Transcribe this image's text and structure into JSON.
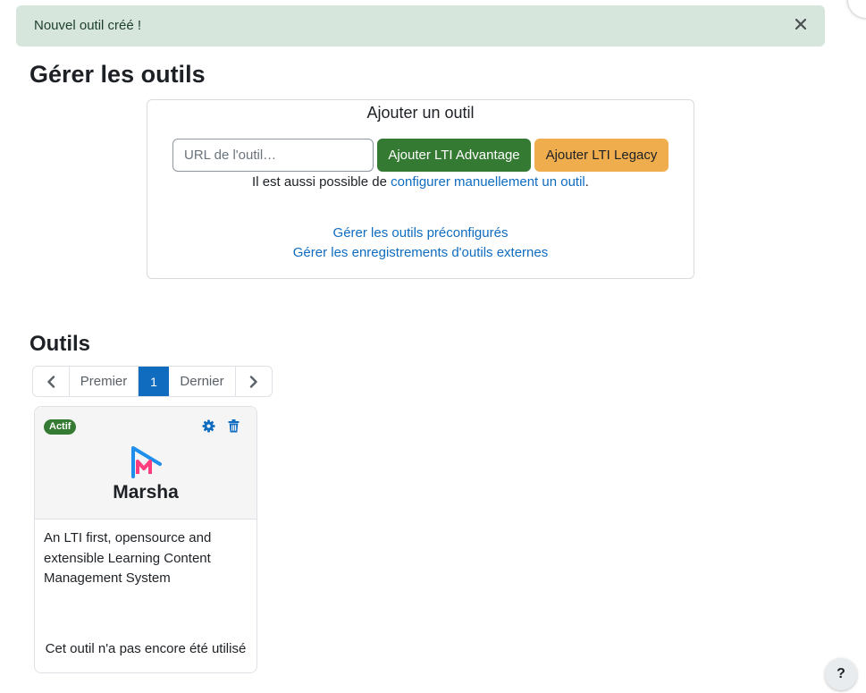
{
  "alert": {
    "message": "Nouvel outil créé !",
    "close_icon": "close-icon"
  },
  "page": {
    "title": "Gérer les outils"
  },
  "add_tool": {
    "heading": "Ajouter un outil",
    "url_placeholder": "URL de l'outil…",
    "url_value": "",
    "advantage_button": "Ajouter LTI Advantage",
    "legacy_button": "Ajouter LTI Legacy",
    "hint_prefix": "Il est aussi possible de ",
    "hint_link": "configurer manuellement un outil",
    "hint_suffix": ".",
    "link_preconfigured": "Gérer les outils préconfigurés",
    "link_registrations": "Gérer les enregistrements d'outils externes"
  },
  "tools_section": {
    "title": "Outils",
    "pagination": {
      "first": "Premier",
      "current": "1",
      "last": "Dernier"
    }
  },
  "tools": [
    {
      "status": "Actif",
      "name": "Marsha",
      "description": "An LTI first, opensource and extensible Learning Content Management System",
      "usage": "Cet outil n'a pas encore été utilisé",
      "icons": [
        "gear-icon",
        "trash-icon"
      ]
    }
  ],
  "help": {
    "label": "?"
  },
  "colors": {
    "alert_bg": "#d7e6dc",
    "primary": "#0f6cbf",
    "success": "#357a32",
    "warning": "#f0ad4e"
  }
}
